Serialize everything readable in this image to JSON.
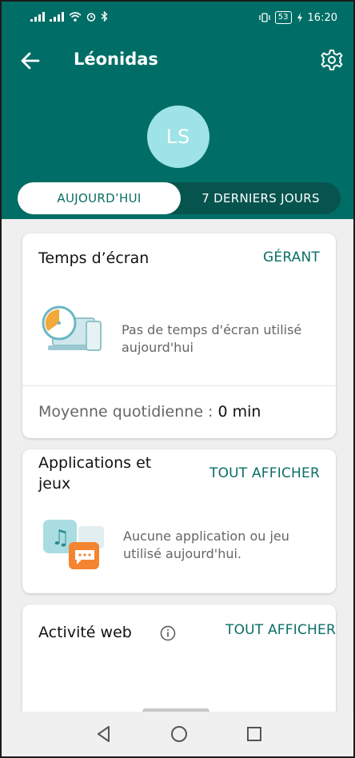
{
  "status_bar": {
    "battery": "53",
    "time": "16:20"
  },
  "app_bar": {
    "title": "Léonidas",
    "avatar_initials": "LS"
  },
  "tabs": {
    "today": "AUJOURD’HUI",
    "last7": "7 DERNIERS JOURS"
  },
  "screen_time_card": {
    "title": "Temps d’écran",
    "action": "GÉRANT",
    "empty_text_line1": "Pas de temps d'écran utilisé",
    "empty_text_line2": "aujourd'hui",
    "average_label": "Moyenne quotidienne : ",
    "average_value": "0 min"
  },
  "apps_card": {
    "title_line1": "Applications et",
    "title_line2": "jeux",
    "action": "TOUT AFFICHER",
    "empty_text_line1": "Aucune application ou jeu",
    "empty_text_line2": "utilisé aujourd'hui."
  },
  "web_card": {
    "title": "Activité web",
    "action": "TOUT AFFICHER"
  },
  "colors": {
    "primary": "#006e66",
    "tab_track": "#07544f",
    "avatar": "#9ee3e6",
    "accent_text": "#0a6e66"
  }
}
